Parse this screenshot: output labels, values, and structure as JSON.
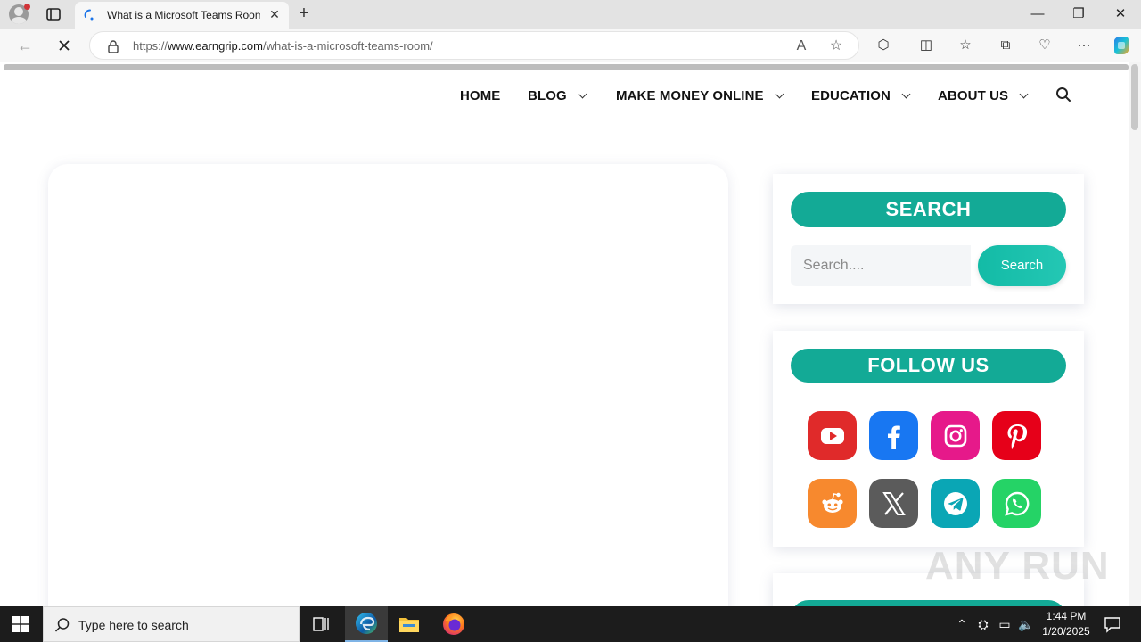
{
  "browser": {
    "tab_title": "What is a Microsoft Teams Room",
    "url_prefix": "https://",
    "url_domain": "www.earngrip.com",
    "url_path": "/what-is-a-microsoft-teams-room/",
    "tab_close_glyph": "✕",
    "new_tab_glyph": "+",
    "window": {
      "minimize": "—",
      "restore": "❐",
      "close": "✕"
    }
  },
  "nav": {
    "items": [
      {
        "label": "HOME",
        "has_dropdown": false
      },
      {
        "label": "BLOG",
        "has_dropdown": true
      },
      {
        "label": "MAKE MONEY ONLINE",
        "has_dropdown": true
      },
      {
        "label": "EDUCATION",
        "has_dropdown": true
      },
      {
        "label": "ABOUT US",
        "has_dropdown": true
      }
    ]
  },
  "sidebar": {
    "search_widget": {
      "title": "SEARCH",
      "placeholder": "Search....",
      "button_label": "Search"
    },
    "follow_widget": {
      "title": "FOLLOW US",
      "networks": [
        {
          "name": "youtube",
          "color": "#e02a2a"
        },
        {
          "name": "facebook",
          "color": "#1877f2"
        },
        {
          "name": "instagram",
          "color": "#e6198a"
        },
        {
          "name": "pinterest",
          "color": "#e60019"
        },
        {
          "name": "reddit",
          "color": "#f7892e"
        },
        {
          "name": "x",
          "color": "#5b5b5b"
        },
        {
          "name": "telegram",
          "color": "#0aa6b5"
        },
        {
          "name": "whatsapp",
          "color": "#25d366"
        }
      ]
    },
    "accent_color": "#13aa96"
  },
  "watermark": "ANY RUN",
  "taskbar": {
    "search_placeholder": "Type here to search",
    "time": "1:44 PM",
    "date": "1/20/2025",
    "pinned": [
      "task-view-icon",
      "edge-icon",
      "file-explorer-icon",
      "firefox-icon"
    ]
  }
}
